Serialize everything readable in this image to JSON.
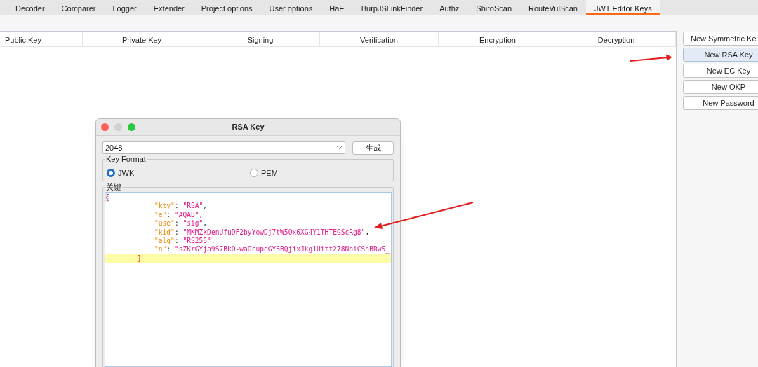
{
  "tabs": [
    {
      "label": "Decoder",
      "selected": false
    },
    {
      "label": "Comparer",
      "selected": false
    },
    {
      "label": "Logger",
      "selected": false
    },
    {
      "label": "Extender",
      "selected": false
    },
    {
      "label": "Project options",
      "selected": false
    },
    {
      "label": "User options",
      "selected": false
    },
    {
      "label": "HaE",
      "selected": false
    },
    {
      "label": "BurpJSLinkFinder",
      "selected": false
    },
    {
      "label": "Authz",
      "selected": false
    },
    {
      "label": "ShiroScan",
      "selected": false
    },
    {
      "label": "RouteVulScan",
      "selected": false
    },
    {
      "label": "JWT Editor Keys",
      "selected": true
    }
  ],
  "table": {
    "columns": [
      "Public Key",
      "Private Key",
      "Signing",
      "Verification",
      "Encryption",
      "Decryption"
    ]
  },
  "key_buttons": [
    {
      "label": "New Symmetric Ke",
      "selected": false
    },
    {
      "label": "New RSA Key",
      "selected": true
    },
    {
      "label": "New EC Key",
      "selected": false
    },
    {
      "label": "New OKP",
      "selected": false
    },
    {
      "label": "New Password",
      "selected": false
    }
  ],
  "dialog": {
    "title": "RSA Key",
    "key_size": "2048",
    "generate_button": "生成",
    "key_format": {
      "legend": "Key Format",
      "options": [
        {
          "label": "JWK",
          "selected": true
        },
        {
          "label": "PEM",
          "selected": false
        }
      ]
    },
    "key_label": "关键",
    "editor": {
      "open": "{",
      "close": "}",
      "lines": [
        {
          "key": "\"kty\"",
          "colon": ":",
          "value": "\"RSA\"",
          "comma": ","
        },
        {
          "key": "\"e\"",
          "colon": ":",
          "value": "\"AQAB\"",
          "comma": ","
        },
        {
          "key": "\"use\"",
          "colon": ":",
          "value": "\"sig\"",
          "comma": ","
        },
        {
          "key": "\"kid\"",
          "colon": ":",
          "value": "\"MKMZkDenUfuDF2byYowDj7tW5Ox6XG4Y1THTEGScRg8\"",
          "comma": ","
        },
        {
          "key": "\"alg\"",
          "colon": ":",
          "value": "\"RS256\"",
          "comma": ","
        },
        {
          "key": "\"n\"",
          "colon": ":",
          "value": "\"sZKrGYja9S7BkO-waOcupoGY6BQjixJkg1Uitt278NbiCSnBRw5_"
        }
      ]
    }
  }
}
